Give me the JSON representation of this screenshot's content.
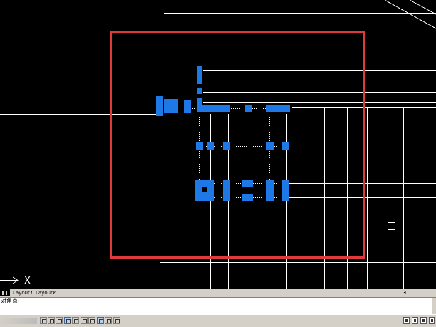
{
  "app": "AutoCAD-style drawing editor",
  "layout_tabs": [
    {
      "label": "Layout1"
    },
    {
      "label": "Layout2"
    }
  ],
  "tab_separator": "/",
  "command_line": {
    "prompt": "对角点:",
    "input_value": ""
  },
  "ucs_marker": {
    "x_label": "X"
  },
  "colors": {
    "background": "#000000",
    "lines": "#ffffff",
    "selection_box": "#e03a3a",
    "grips": "#1e78e6",
    "chrome": "#d4d0c8"
  },
  "status_toolbar": {
    "buttons": [
      "snap-icon",
      "grid-icon",
      "ortho-icon",
      "polar-icon",
      "osnap-icon",
      "otrack-icon",
      "ducs-icon",
      "dyn-icon",
      "lwt-icon",
      "model-icon",
      "qp-icon",
      "sc-icon",
      "am-icon"
    ]
  }
}
